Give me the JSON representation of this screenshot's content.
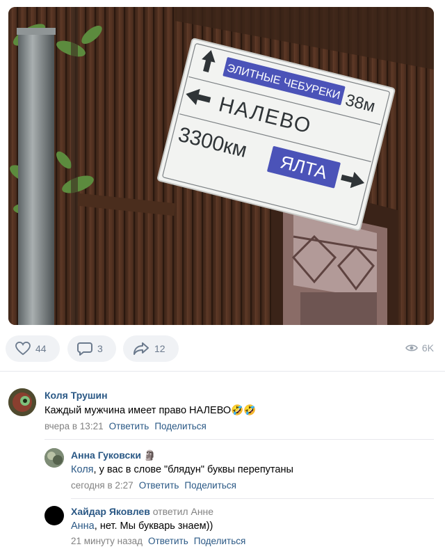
{
  "post": {
    "photo": {
      "sign_line1": "ЭЛИТНЫЕ ЧЕБУРЕКИ",
      "sign_distance1": "38м",
      "sign_line2": "НАЛЕВО",
      "sign_distance2": "3300км",
      "sign_city": "ЯЛТА"
    },
    "actions": {
      "likes": "44",
      "comments": "3",
      "shares": "12",
      "views": "6K",
      "icons": [
        "heart-icon",
        "comment-icon",
        "share-icon",
        "eye-icon"
      ]
    }
  },
  "comments": [
    {
      "author": "Коля Трушин",
      "text": "Каждый мужчина имеет право НАЛЕВО🤣🤣",
      "time": "вчера в 13:21",
      "reply_label": "Ответить",
      "share_label": "Поделиться"
    },
    {
      "author": "Анна Гуковски",
      "author_badge": "🗿",
      "mention": "Коля",
      "text": ", у вас в слове \"блядун\" буквы перепутаны",
      "time": "сегодня в 2:27",
      "reply_label": "Ответить",
      "share_label": "Поделиться"
    },
    {
      "author": "Хайдар Яковлев",
      "reply_to": "ответил Анне",
      "mention": "Анна",
      "text": ", нет. Мы букварь знаем))",
      "time": "21 минуту назад",
      "reply_label": "Ответить",
      "share_label": "Поделиться"
    }
  ],
  "colors": {
    "link": "#2a5885",
    "muted": "#828282",
    "pill_bg": "#f0f2f5",
    "sign_blue": "#4b53b8"
  }
}
